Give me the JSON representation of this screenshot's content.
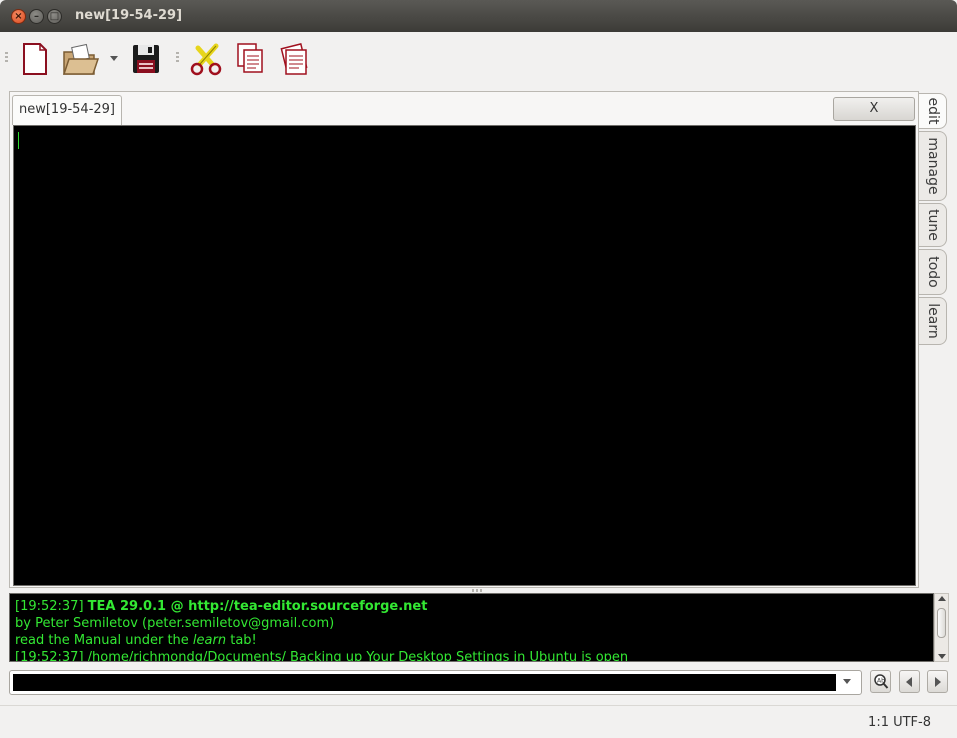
{
  "window": {
    "title": "new[19-54-29]",
    "buttons": {
      "close": "×",
      "minimize": "–",
      "maximize": "□"
    }
  },
  "toolbar": {
    "icons": [
      "new-file-icon",
      "open-folder-icon",
      "save-floppy-icon",
      "cut-scissors-icon",
      "copy-icon",
      "paste-icon"
    ]
  },
  "tabs": {
    "document_tab": "new[19-54-29]",
    "close_label": "X"
  },
  "side_tabs": [
    "edit",
    "manage",
    "tune",
    "todo",
    "learn"
  ],
  "log": {
    "line1_time": "[19:52:37] ",
    "line1_bold": "TEA 29.0.1 @ http://tea-editor.sourceforge.net",
    "line2": "by Peter Semiletov (peter.semiletov@gmail.com)",
    "line3_pre": "read the Manual under the ",
    "line3_em": "learn",
    "line3_post": " tab!",
    "line4": "[19:52:37] /home/richmondg/Documents/ Backing up Your Desktop Settings in Ubuntu is open"
  },
  "command": {
    "value": ""
  },
  "status": {
    "text": "1:1 UTF-8"
  },
  "colors": {
    "editor_bg": "#000000",
    "log_text": "#33e833",
    "titlebar": "#3c3b37"
  }
}
